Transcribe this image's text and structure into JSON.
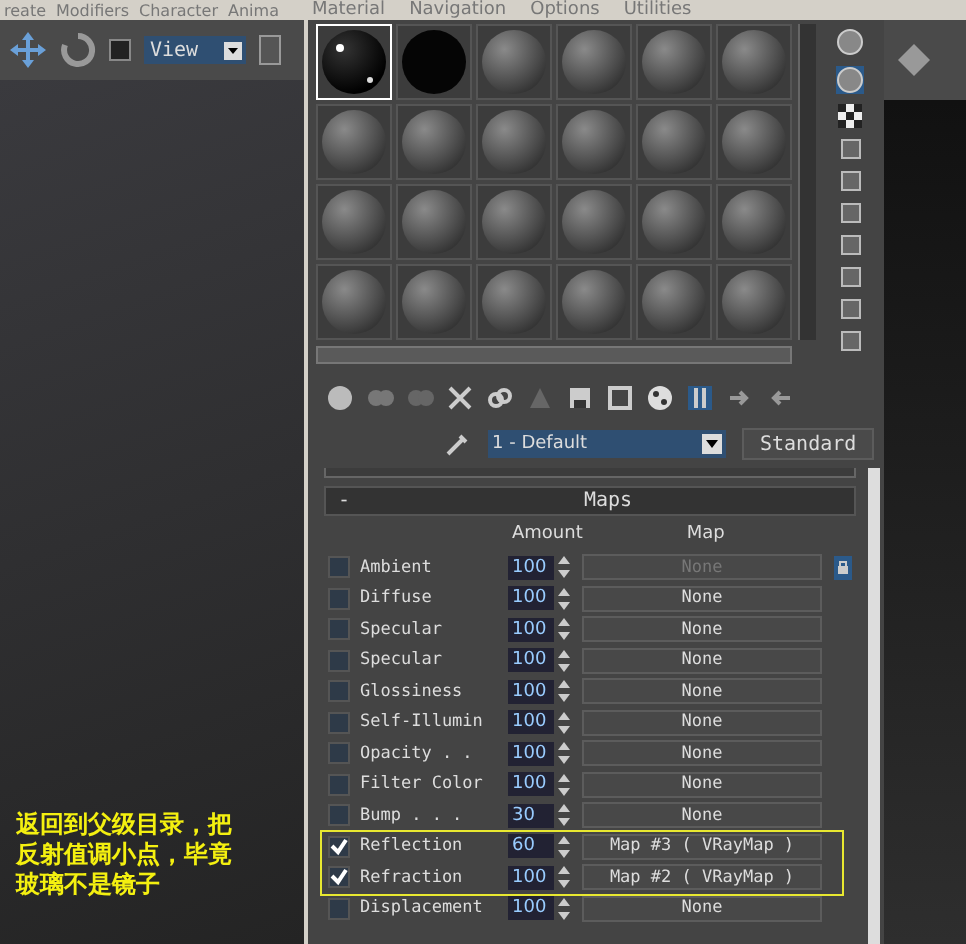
{
  "main_menu": [
    "reate",
    "Modifiers",
    "Character",
    "Anima"
  ],
  "viewport_toolbar": {
    "view_dropdown": "View"
  },
  "annotation": {
    "lines": [
      "返回到父级目录，把",
      "反射值调小点，毕竟",
      "玻璃不是镜子"
    ]
  },
  "material_editor": {
    "menu": [
      "Material",
      "Navigation",
      "Options",
      "Utilities"
    ],
    "sample_slots": [
      {
        "kind": "glossy",
        "selected": true
      },
      {
        "kind": "black",
        "selected": false
      },
      {
        "kind": "grey",
        "selected": false
      },
      {
        "kind": "grey",
        "selected": false
      },
      {
        "kind": "grey",
        "selected": false
      },
      {
        "kind": "grey",
        "selected": false
      },
      {
        "kind": "grey",
        "selected": false
      },
      {
        "kind": "grey",
        "selected": false
      },
      {
        "kind": "grey",
        "selected": false
      },
      {
        "kind": "grey",
        "selected": false
      },
      {
        "kind": "grey",
        "selected": false
      },
      {
        "kind": "grey",
        "selected": false
      },
      {
        "kind": "grey",
        "selected": false
      },
      {
        "kind": "grey",
        "selected": false
      },
      {
        "kind": "grey",
        "selected": false
      },
      {
        "kind": "grey",
        "selected": false
      },
      {
        "kind": "grey",
        "selected": false
      },
      {
        "kind": "grey",
        "selected": false
      },
      {
        "kind": "grey",
        "selected": false
      },
      {
        "kind": "grey",
        "selected": false
      },
      {
        "kind": "grey",
        "selected": false
      },
      {
        "kind": "grey",
        "selected": false
      },
      {
        "kind": "grey",
        "selected": false
      },
      {
        "kind": "grey",
        "selected": false
      }
    ],
    "material_name": "1 - Default",
    "material_type": "Standard",
    "maps": {
      "toggle": "-",
      "title": "Maps",
      "columns": [
        "Amount",
        "Map"
      ],
      "rows": [
        {
          "name": "Ambient",
          "checked": false,
          "amount": "100",
          "map": "None",
          "disabled": true,
          "highlighted": false
        },
        {
          "name": "Diffuse",
          "checked": false,
          "amount": "100",
          "map": "None",
          "disabled": false,
          "highlighted": false
        },
        {
          "name": "Specular",
          "checked": false,
          "amount": "100",
          "map": "None",
          "disabled": false,
          "highlighted": false
        },
        {
          "name": "Specular",
          "checked": false,
          "amount": "100",
          "map": "None",
          "disabled": false,
          "highlighted": false
        },
        {
          "name": "Glossiness",
          "checked": false,
          "amount": "100",
          "map": "None",
          "disabled": false,
          "highlighted": false
        },
        {
          "name": "Self-Illumin",
          "checked": false,
          "amount": "100",
          "map": "None",
          "disabled": false,
          "highlighted": false
        },
        {
          "name": "Opacity . .",
          "checked": false,
          "amount": "100",
          "map": "None",
          "disabled": false,
          "highlighted": false
        },
        {
          "name": "Filter Color",
          "checked": false,
          "amount": "100",
          "map": "None",
          "disabled": false,
          "highlighted": false
        },
        {
          "name": "Bump . . .",
          "checked": false,
          "amount": "30",
          "map": "None",
          "disabled": false,
          "highlighted": false
        },
        {
          "name": "Reflection",
          "checked": true,
          "amount": "60",
          "map": "Map #3  ( VRayMap )",
          "disabled": false,
          "highlighted": true
        },
        {
          "name": "Refraction",
          "checked": true,
          "amount": "100",
          "map": "Map #2  ( VRayMap )",
          "disabled": false,
          "highlighted": true
        },
        {
          "name": "Displacement",
          "checked": false,
          "amount": "100",
          "map": "None",
          "disabled": false,
          "highlighted": false
        }
      ]
    }
  }
}
